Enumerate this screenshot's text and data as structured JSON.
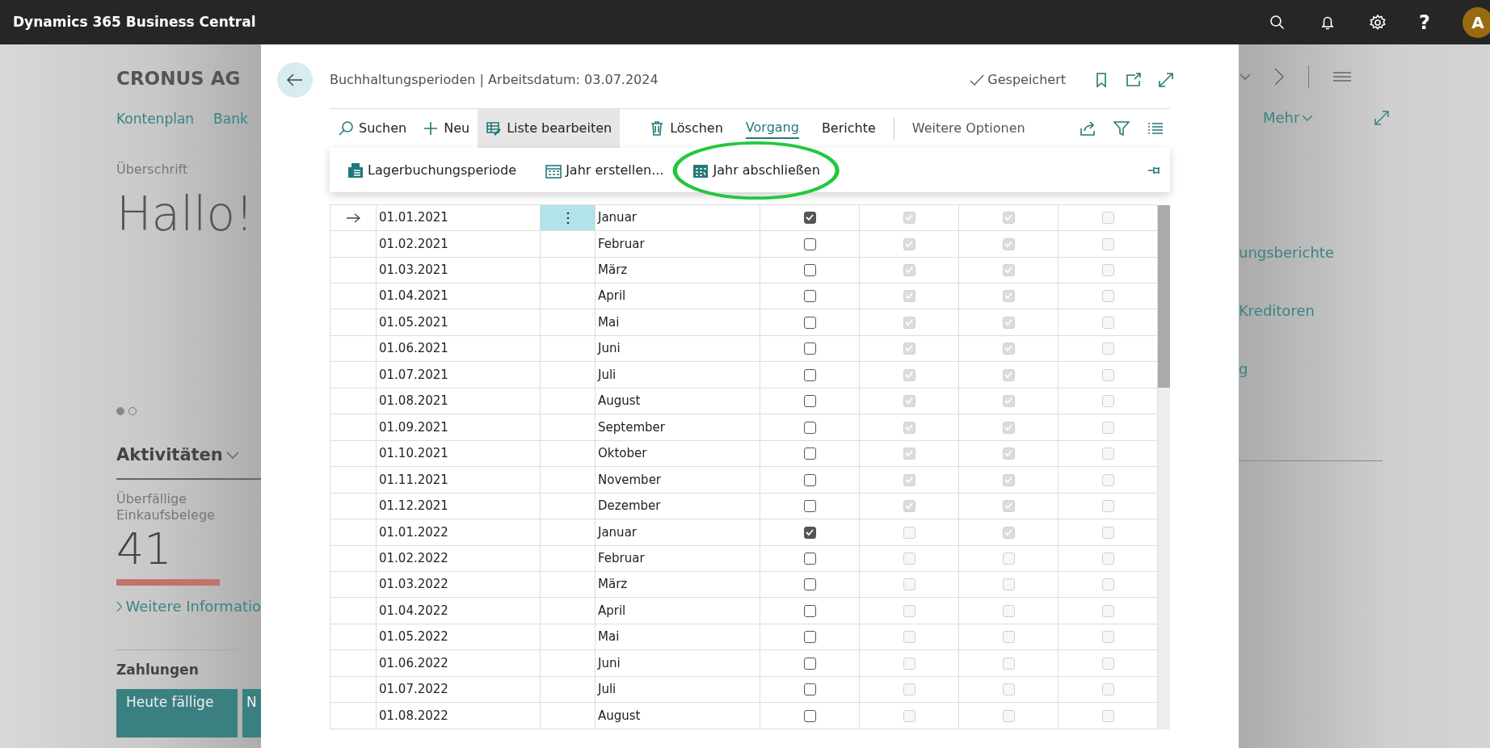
{
  "app_bar": {
    "title": "Dynamics 365 Business Central",
    "help": "?",
    "avatar": "A"
  },
  "background": {
    "company": "CRONUS AG",
    "nav_links": [
      "Kontenplan",
      "Bank"
    ],
    "heading_label": "Überschrift",
    "greeting": "Hallo!",
    "carousel_dots": [
      {
        "selected": true
      },
      {
        "selected": false
      }
    ],
    "activities": {
      "title": "Aktivitäten",
      "cue_label": "Überfällige Einkaufsbelege",
      "cue_value": "41",
      "more_link": "Weitere Informatio"
    },
    "payments": {
      "title": "Zahlungen",
      "tiles": [
        "Heute fällige",
        "N"
      ]
    },
    "more_menu": "Mehr",
    "right_links": [
      "ungsberichte",
      "Kreditoren",
      "g"
    ]
  },
  "dialog": {
    "title": "Buchhaltungsperioden | Arbeitsdatum: 03.07.2024",
    "save_status": "Gespeichert",
    "toolbar": [
      {
        "kind": "search",
        "label": "Suchen",
        "selected": false,
        "pressed": false
      },
      {
        "kind": "new",
        "label": "Neu",
        "selected": false,
        "pressed": false
      },
      {
        "kind": "edit-list",
        "label": "Liste bearbeiten",
        "selected": false,
        "pressed": true
      },
      {
        "kind": "delete",
        "label": "Löschen",
        "selected": false,
        "pressed": false
      },
      {
        "kind": "menu",
        "label": "Vorgang",
        "selected": true,
        "pressed": false
      },
      {
        "kind": "menu",
        "label": "Berichte",
        "selected": false,
        "pressed": false
      },
      {
        "kind": "more",
        "label": "Weitere Optionen",
        "selected": false,
        "pressed": false
      }
    ],
    "actions": [
      {
        "kind": "inventory",
        "label": "Lagerbuchungsperiode",
        "highlighted": false
      },
      {
        "kind": "create-year",
        "label": "Jahr erstellen...",
        "highlighted": false
      },
      {
        "kind": "close-year",
        "label": "Jahr abschließen",
        "highlighted": true
      }
    ],
    "table": {
      "check_columns": [
        {
          "disabled": false
        },
        {
          "disabled": true
        },
        {
          "disabled": true
        },
        {
          "disabled": true
        }
      ],
      "rows": [
        {
          "date": "01.01.2021",
          "name": "Januar",
          "selected": true,
          "checks": [
            true,
            true,
            true,
            false
          ]
        },
        {
          "date": "01.02.2021",
          "name": "Februar",
          "selected": false,
          "checks": [
            false,
            true,
            true,
            false
          ]
        },
        {
          "date": "01.03.2021",
          "name": "März",
          "selected": false,
          "checks": [
            false,
            true,
            true,
            false
          ]
        },
        {
          "date": "01.04.2021",
          "name": "April",
          "selected": false,
          "checks": [
            false,
            true,
            true,
            false
          ]
        },
        {
          "date": "01.05.2021",
          "name": "Mai",
          "selected": false,
          "checks": [
            false,
            true,
            true,
            false
          ]
        },
        {
          "date": "01.06.2021",
          "name": "Juni",
          "selected": false,
          "checks": [
            false,
            true,
            true,
            false
          ]
        },
        {
          "date": "01.07.2021",
          "name": "Juli",
          "selected": false,
          "checks": [
            false,
            true,
            true,
            false
          ]
        },
        {
          "date": "01.08.2021",
          "name": "August",
          "selected": false,
          "checks": [
            false,
            true,
            true,
            false
          ]
        },
        {
          "date": "01.09.2021",
          "name": "September",
          "selected": false,
          "checks": [
            false,
            true,
            true,
            false
          ]
        },
        {
          "date": "01.10.2021",
          "name": "Oktober",
          "selected": false,
          "checks": [
            false,
            true,
            true,
            false
          ]
        },
        {
          "date": "01.11.2021",
          "name": "November",
          "selected": false,
          "checks": [
            false,
            true,
            true,
            false
          ]
        },
        {
          "date": "01.12.2021",
          "name": "Dezember",
          "selected": false,
          "checks": [
            false,
            true,
            true,
            false
          ]
        },
        {
          "date": "01.01.2022",
          "name": "Januar",
          "selected": false,
          "checks": [
            true,
            false,
            true,
            false
          ]
        },
        {
          "date": "01.02.2022",
          "name": "Februar",
          "selected": false,
          "checks": [
            false,
            false,
            false,
            false
          ]
        },
        {
          "date": "01.03.2022",
          "name": "März",
          "selected": false,
          "checks": [
            false,
            false,
            false,
            false
          ]
        },
        {
          "date": "01.04.2022",
          "name": "April",
          "selected": false,
          "checks": [
            false,
            false,
            false,
            false
          ]
        },
        {
          "date": "01.05.2022",
          "name": "Mai",
          "selected": false,
          "checks": [
            false,
            false,
            false,
            false
          ]
        },
        {
          "date": "01.06.2022",
          "name": "Juni",
          "selected": false,
          "checks": [
            false,
            false,
            false,
            false
          ]
        },
        {
          "date": "01.07.2022",
          "name": "Juli",
          "selected": false,
          "checks": [
            false,
            false,
            false,
            false
          ]
        },
        {
          "date": "01.08.2022",
          "name": "August",
          "selected": false,
          "checks": [
            false,
            false,
            false,
            false
          ]
        }
      ]
    }
  }
}
